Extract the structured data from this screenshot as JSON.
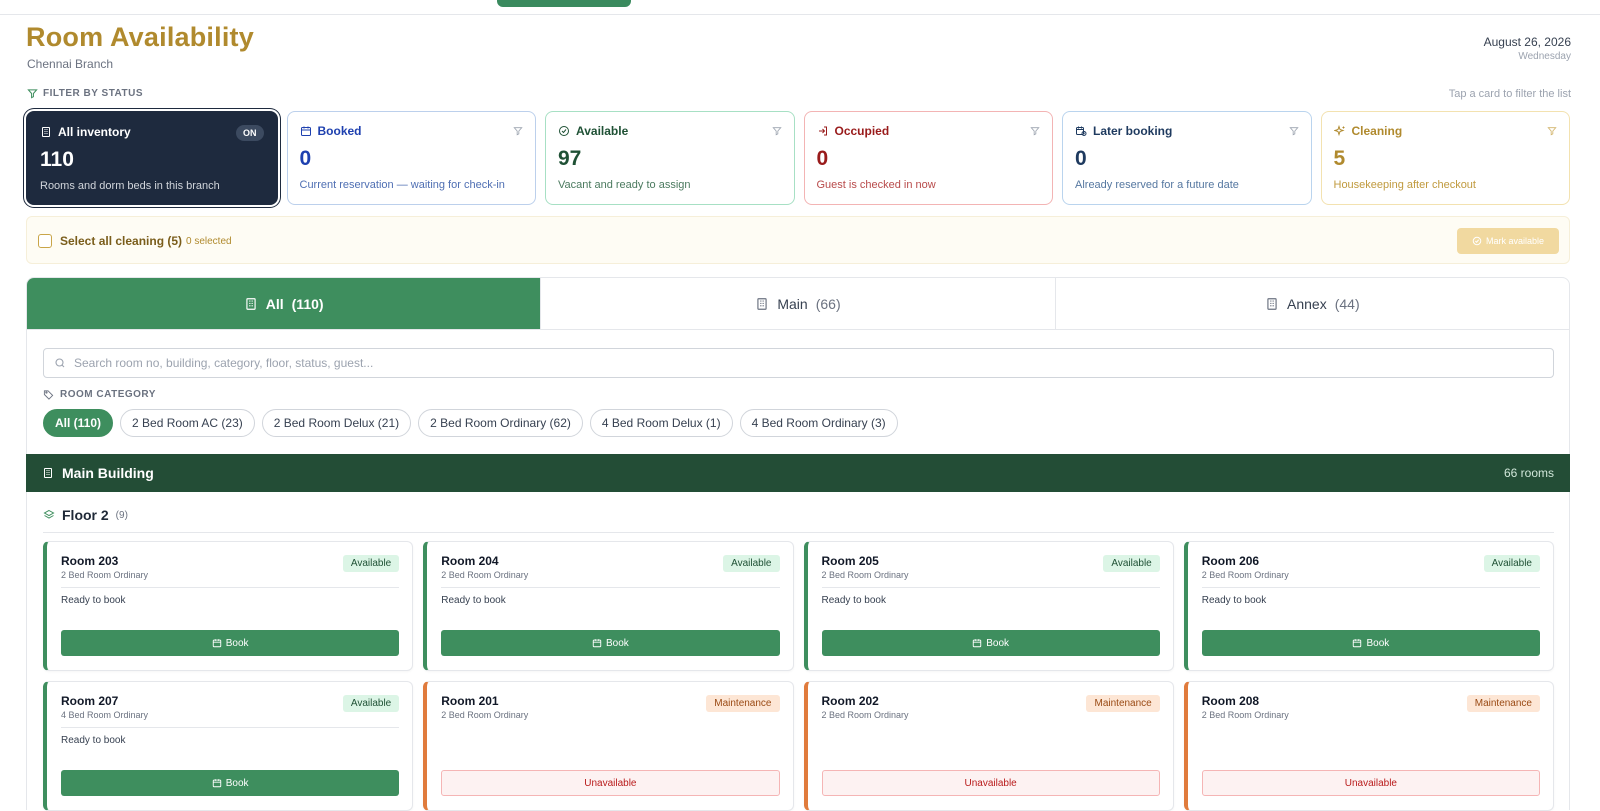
{
  "header": {
    "title": "Room Availability",
    "branch": "Chennai Branch",
    "date": "August 26, 2026",
    "weekday": "Wednesday"
  },
  "filter": {
    "label": "FILTER BY STATUS",
    "hint": "Tap a card to filter the list"
  },
  "cards": {
    "inventory": {
      "label": "All inventory",
      "toggle": "ON",
      "count": "110",
      "desc": "Rooms and dorm beds in this branch"
    },
    "booked": {
      "label": "Booked",
      "count": "0",
      "desc": "Current reservation — waiting for check-in"
    },
    "available": {
      "label": "Available",
      "count": "97",
      "desc": "Vacant and ready to assign"
    },
    "occupied": {
      "label": "Occupied",
      "count": "0",
      "desc": "Guest is checked in now"
    },
    "later": {
      "label": "Later booking",
      "count": "0",
      "desc": "Already reserved for a future date"
    },
    "cleaning": {
      "label": "Cleaning",
      "count": "5",
      "desc": "Housekeeping after checkout"
    }
  },
  "select_bar": {
    "label": "Select all cleaning (5)",
    "selected": "0 selected",
    "mark_label": "Mark available"
  },
  "tabs": [
    {
      "label": "All",
      "count": "(110)"
    },
    {
      "label": "Main",
      "count": "(66)"
    },
    {
      "label": "Annex",
      "count": "(44)"
    }
  ],
  "search": {
    "placeholder": "Search room no, building, category, floor, status, guest..."
  },
  "category": {
    "label": "ROOM CATEGORY",
    "chips": [
      "All (110)",
      "2 Bed Room AC (23)",
      "2 Bed Room Delux (21)",
      "2 Bed Room Ordinary (62)",
      "4 Bed Room Delux (1)",
      "4 Bed Room Ordinary (3)"
    ]
  },
  "building": {
    "name": "Main Building",
    "rooms": "66 rooms"
  },
  "floor": {
    "name": "Floor 2",
    "count": "(9)"
  },
  "rooms": [
    {
      "name": "Room 203",
      "category": "2 Bed Room Ordinary",
      "status": "Available",
      "note": "Ready to book",
      "action": "Book"
    },
    {
      "name": "Room 204",
      "category": "2 Bed Room Ordinary",
      "status": "Available",
      "note": "Ready to book",
      "action": "Book"
    },
    {
      "name": "Room 205",
      "category": "2 Bed Room Ordinary",
      "status": "Available",
      "note": "Ready to book",
      "action": "Book"
    },
    {
      "name": "Room 206",
      "category": "2 Bed Room Ordinary",
      "status": "Available",
      "note": "Ready to book",
      "action": "Book"
    },
    {
      "name": "Room 207",
      "category": "4 Bed Room Ordinary",
      "status": "Available",
      "note": "Ready to book",
      "action": "Book"
    },
    {
      "name": "Room 201",
      "category": "2 Bed Room Ordinary",
      "status": "Maintenance",
      "action": "Unavailable"
    },
    {
      "name": "Room 202",
      "category": "2 Bed Room Ordinary",
      "status": "Maintenance",
      "action": "Unavailable"
    },
    {
      "name": "Room 208",
      "category": "2 Bed Room Ordinary",
      "status": "Maintenance",
      "action": "Unavailable"
    }
  ],
  "colors": {
    "brand_gold": "#b08a2e",
    "brand_green": "#3e8e5e",
    "dark_green": "#234d36",
    "navy": "#1e2a3e",
    "maintenance": "#e07b3c"
  }
}
